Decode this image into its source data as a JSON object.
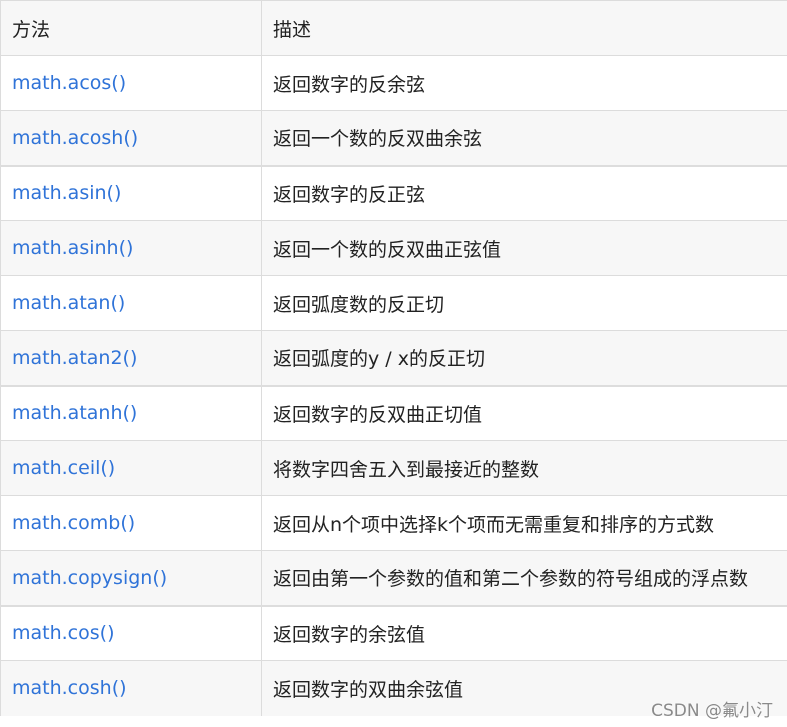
{
  "table": {
    "headers": [
      "方法",
      "描述"
    ],
    "rows": [
      {
        "method": "math.acos()",
        "desc": "返回数字的反余弦"
      },
      {
        "method": "math.acosh()",
        "desc": "返回一个数的反双曲余弦"
      },
      {
        "method": "math.asin()",
        "desc": "返回数字的反正弦"
      },
      {
        "method": "math.asinh()",
        "desc": "返回一个数的反双曲正弦值"
      },
      {
        "method": "math.atan()",
        "desc": "返回弧度数的反正切"
      },
      {
        "method": "math.atan2()",
        "desc": "返回弧度的y / x的反正切"
      },
      {
        "method": "math.atanh()",
        "desc": "返回数字的反双曲正切值"
      },
      {
        "method": "math.ceil()",
        "desc": "将数字四舍五入到最接近的整数"
      },
      {
        "method": "math.comb()",
        "desc": "返回从n个项中选择k个项而无需重复和排序的方式数"
      },
      {
        "method": "math.copysign()",
        "desc": "返回由第一个参数的值和第二个参数的符号组成的浮点数"
      },
      {
        "method": "math.cos()",
        "desc": "返回数字的余弦值"
      },
      {
        "method": "math.cosh()",
        "desc": "返回数字的双曲余弦值"
      }
    ]
  },
  "watermark": "CSDN @氟小汀",
  "colors": {
    "link": "#2f73d8",
    "text": "#222222",
    "row_alt": "#f7f7f7",
    "border": "#dcdcdc"
  }
}
